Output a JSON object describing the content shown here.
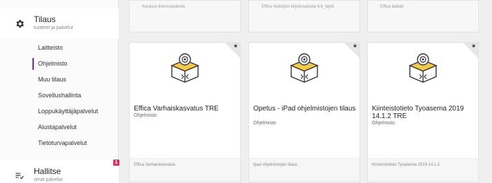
{
  "sidebar": {
    "tilaus": {
      "title": "Tilaus",
      "subtitle": "tuotteet ja palvelut",
      "icon": "gear-icon"
    },
    "items": [
      {
        "label": "Laitteisto"
      },
      {
        "label": "Ohjelmisto",
        "active": true
      },
      {
        "label": "Muu tilaus"
      },
      {
        "label": "Sovellushallinta"
      },
      {
        "label": "Loppukäyttäjäpalvelut"
      },
      {
        "label": "Alustapalvelut"
      },
      {
        "label": "Tietoturvapalvelut"
      }
    ],
    "hallitse": {
      "title": "Hallitse",
      "subtitle": "omat palvelut",
      "icon": "list-check-icon",
      "badge": "1"
    }
  },
  "top_cards": [
    {
      "footer": "Kouluun lisenssipalvelu"
    },
    {
      "footer": "Effica hoitotyön kirjoitusalusta 4.6_täytö"
    },
    {
      "footer": "Effica lääkäri"
    }
  ],
  "cards": [
    {
      "title": "Effica Varhaiskasvatus TRE",
      "type": "Ohjelmisto",
      "footer": "Effica Varhaiskasvatus",
      "star": "★"
    },
    {
      "title": "Opetus - iPad ohjelmistojen tilaus",
      "type": "Ohjelmisto",
      "footer": "Ipad ohjelmistojen tilaus",
      "star": "★"
    },
    {
      "title": "Kiinteistotieto Tyoasema 2019 14.1.2 TRE",
      "type": "Ohjelmisto",
      "footer": "Kiinteistotieto Tyoasema 2019 14.1.2",
      "star": "★"
    }
  ],
  "colors": {
    "accent": "#6a2c91",
    "badge": "#d8345f",
    "icon_yellow": "#f2c94c"
  }
}
